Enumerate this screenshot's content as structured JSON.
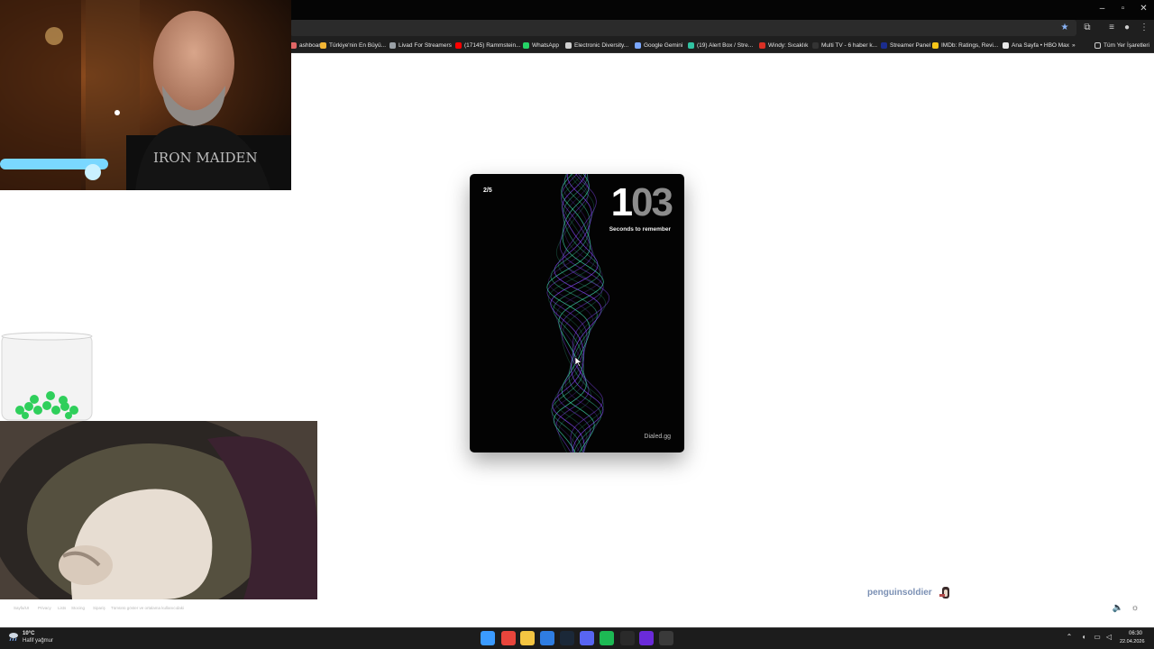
{
  "browser": {
    "window_controls": {
      "minimize": "–",
      "maximize": "▫",
      "close": "✕"
    },
    "bookmarks": [
      {
        "label": "ashboard",
        "color": "#e06666"
      },
      {
        "label": "Türkiye'nin En Büyü...",
        "color": "#f1b434"
      },
      {
        "label": "Livad For Streamers",
        "color": "#9aa0a6"
      },
      {
        "label": "(17145) Rammstein...",
        "color": "#ff0000"
      },
      {
        "label": "WhatsApp",
        "color": "#25d366"
      },
      {
        "label": "Electronic Diversity...",
        "color": "#cfcfcf"
      },
      {
        "label": "Google Gemini",
        "color": "#7aa7ff"
      },
      {
        "label": "(19) Alert Box / Stre...",
        "color": "#31c3a2"
      },
      {
        "label": "Windy: Sıcaklık",
        "color": "#d93025"
      },
      {
        "label": "Multi TV - 6 haber k...",
        "color": "#333333"
      },
      {
        "label": "Streamer Panel",
        "color": "#1b2d8f"
      },
      {
        "label": "IMDb: Ratings, Revi...",
        "color": "#f5c518"
      },
      {
        "label": "Ana Sayfa • HBO Max",
        "color": "#e8e8e8"
      }
    ],
    "overflow_label": "»",
    "all_bookmarks_label": "Tüm Yer İşaretleri"
  },
  "app": {
    "progress": "2/5",
    "timer_lead": "1",
    "timer_rest": "03",
    "timer_label": "Seconds to remember",
    "brand": "Dialed.gg"
  },
  "overlay": {
    "streamer_name": "penguinsoldier",
    "footer_items": [
      "Sayfa/UI",
      "Privacy",
      "Lists",
      "Stocing",
      "Sipariş",
      "Tümünü göster ve ortalama kullanıcıdaki"
    ]
  },
  "taskbar": {
    "weather_temp": "10°C",
    "weather_desc": "Hafif yağmur",
    "time": "06:30",
    "date": "22.04.2026",
    "apps": [
      {
        "name": "start",
        "color": "#3b9bff"
      },
      {
        "name": "chrome",
        "color": "#e8453c"
      },
      {
        "name": "file-explorer",
        "color": "#f4c542"
      },
      {
        "name": "browser-alt",
        "color": "#2f7de1"
      },
      {
        "name": "steam",
        "color": "#1b2838"
      },
      {
        "name": "discord",
        "color": "#5865f2"
      },
      {
        "name": "spotify",
        "color": "#1db954"
      },
      {
        "name": "epic-games",
        "color": "#2a2a2a"
      },
      {
        "name": "next-app",
        "color": "#6a2bd9"
      },
      {
        "name": "obs",
        "color": "#3a3a3a"
      }
    ]
  },
  "colors": {
    "wave_primary": "#3fd7a8",
    "wave_secondary": "#8a4bff",
    "card_bg": "#030303",
    "chrome_bg": "#1f1f1f"
  }
}
